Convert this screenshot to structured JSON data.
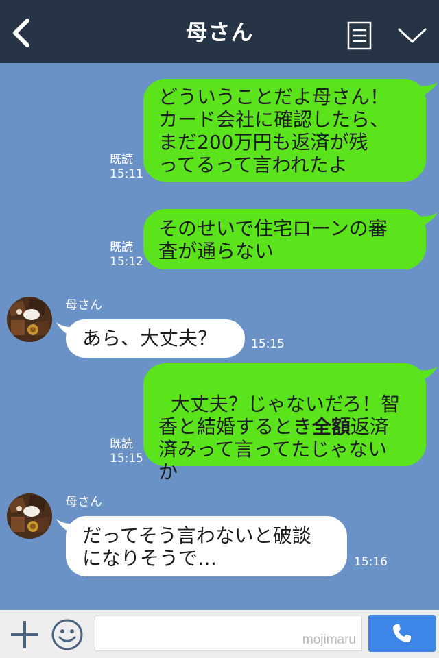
{
  "header": {
    "title": "母さん"
  },
  "messages": [
    {
      "side": "right",
      "text": "どういうことだよ母さん！\nカード会社に確認したら、\nまだ200万円も返済が残\nってるって言われたよ",
      "read": "既読",
      "time": "15:11"
    },
    {
      "side": "right",
      "text": "そのせいで住宅ローンの審\n査が通らない",
      "read": "既読",
      "time": "15:12"
    },
    {
      "side": "left",
      "sender": "母さん",
      "text": "あら、大丈夫？",
      "time": "15:15"
    },
    {
      "side": "right",
      "text_a": "大丈夫？じゃないだろ！智\n香と結婚するとき",
      "text_bold": "全額",
      "text_b": "返済\n済みって言ってたじゃない\nか",
      "read": "既読",
      "time": "15:15"
    },
    {
      "side": "left",
      "sender": "母さん",
      "text": "だってそう言わないと破談\nになりそうで…",
      "time": "15:16"
    }
  ],
  "footer": {
    "watermark": "mojimaru"
  },
  "colors": {
    "background": "#6a92c6",
    "header": "#273446",
    "sent_bubble": "#5be41c",
    "received_bubble": "#ffffff",
    "send_button": "#3d86e8"
  },
  "icons": [
    "back-icon",
    "menu-icon",
    "chevron-down-icon",
    "plus-icon",
    "emoji-icon",
    "phone-icon"
  ]
}
